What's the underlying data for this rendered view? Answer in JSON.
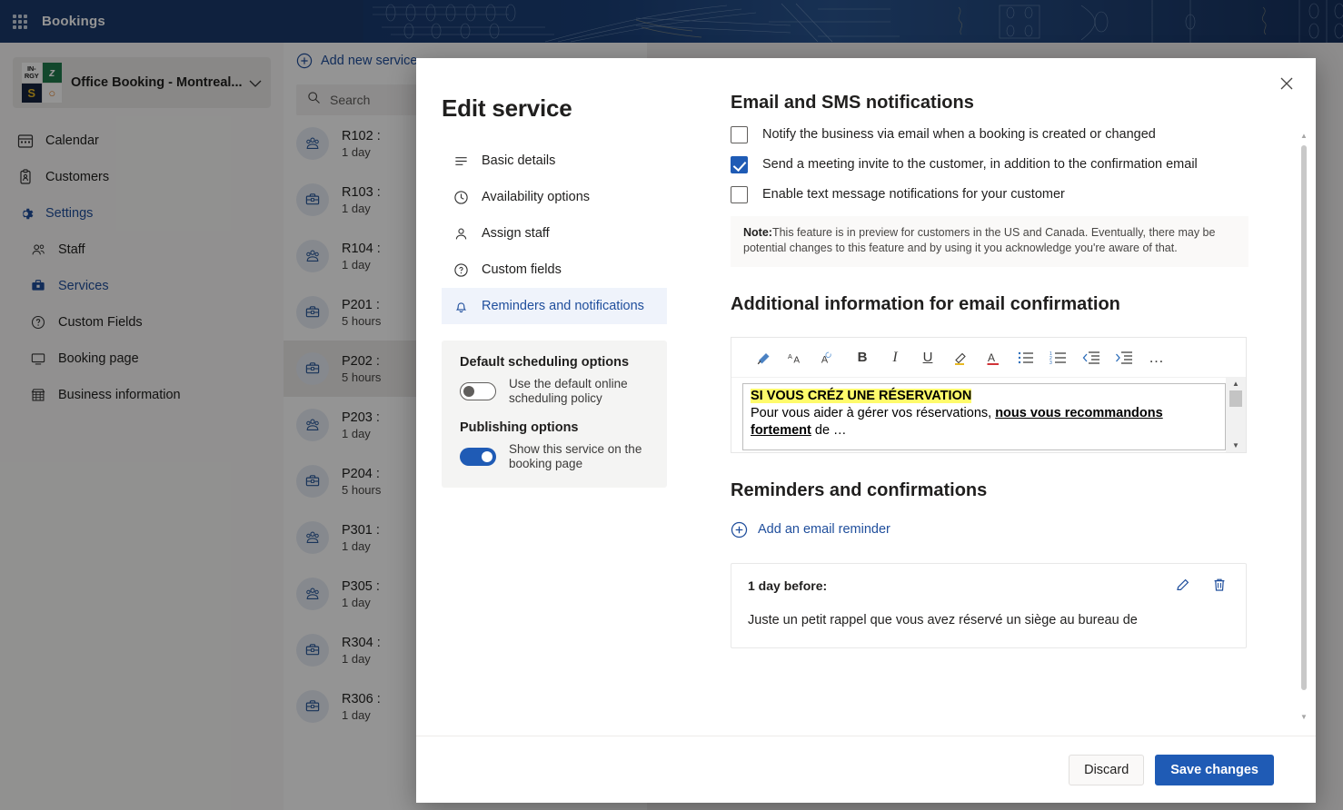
{
  "colors": {
    "brand_blue": "#1f5bb5",
    "link_blue": "#1f4e9c",
    "banner_navy": "#15325e",
    "highlight_yellow": "#fffb6b"
  },
  "topbar": {
    "waffle_icon": "app-launcher-grid-icon",
    "app_title": "Bookings"
  },
  "left_rail": {
    "tenant": {
      "logo_tiles": [
        "IN-RGY",
        "z",
        "S",
        "○"
      ],
      "name": "Office Booking - Montreal...",
      "chevron_icon": "chevron-down-icon"
    },
    "nav": [
      {
        "label": "Calendar",
        "icon": "calendar-icon",
        "active": false,
        "sub": false
      },
      {
        "label": "Customers",
        "icon": "customers-icon",
        "active": false,
        "sub": false
      },
      {
        "label": "Settings",
        "icon": "gear-icon",
        "active": true,
        "sub": false
      },
      {
        "label": "Staff",
        "icon": "people-icon",
        "active": false,
        "sub": true
      },
      {
        "label": "Services",
        "icon": "toolbox-icon",
        "active": true,
        "sub": true
      },
      {
        "label": "Custom Fields",
        "icon": "question-circle-icon",
        "active": false,
        "sub": true
      },
      {
        "label": "Booking page",
        "icon": "monitor-icon",
        "active": false,
        "sub": true
      },
      {
        "label": "Business information",
        "icon": "storefront-icon",
        "active": false,
        "sub": true
      }
    ]
  },
  "service_list": {
    "add_new_label": "Add new service",
    "add_new_icon": "circle-plus-icon",
    "search_placeholder": "Search",
    "search_icon": "search-icon",
    "items": [
      {
        "name": "R102 :",
        "duration": "1 day",
        "icon": "people-icon",
        "selected": false
      },
      {
        "name": "R103 :",
        "duration": "1 day",
        "icon": "toolbox-icon",
        "selected": false
      },
      {
        "name": "R104 :",
        "duration": "1 day",
        "icon": "people-icon",
        "selected": false
      },
      {
        "name": "P201 :",
        "duration": "5 hours",
        "icon": "toolbox-icon",
        "selected": false
      },
      {
        "name": "P202 :",
        "duration": "5 hours",
        "icon": "toolbox-icon",
        "selected": true
      },
      {
        "name": "P203 :",
        "duration": "1 day",
        "icon": "people-icon",
        "selected": false
      },
      {
        "name": "P204 :",
        "duration": "5 hours",
        "icon": "toolbox-icon",
        "selected": false
      },
      {
        "name": "P301 :",
        "duration": "1 day",
        "icon": "people-icon",
        "selected": false
      },
      {
        "name": "P305 :",
        "duration": "1 day",
        "icon": "people-icon",
        "selected": false
      },
      {
        "name": "R304 :",
        "duration": "1 day",
        "icon": "toolbox-icon",
        "selected": false
      },
      {
        "name": "R306 :",
        "duration": "1 day",
        "icon": "toolbox-icon",
        "selected": false
      }
    ]
  },
  "modal": {
    "title": "Edit service",
    "close_icon": "close-icon",
    "nav": [
      {
        "label": "Basic details",
        "icon": "list-lines-icon",
        "active": false
      },
      {
        "label": "Availability options",
        "icon": "clock-icon",
        "active": false
      },
      {
        "label": "Assign staff",
        "icon": "person-icon",
        "active": false
      },
      {
        "label": "Custom fields",
        "icon": "question-circle-icon",
        "active": false
      },
      {
        "label": "Reminders and notifications",
        "icon": "bell-icon",
        "active": true
      }
    ],
    "options_card": {
      "default_scheduling_heading": "Default scheduling options",
      "default_scheduling_label": "Use the default online scheduling policy",
      "default_scheduling_on": false,
      "publishing_heading": "Publishing options",
      "publishing_label": "Show this service on the booking page",
      "publishing_on": true
    },
    "notifications": {
      "heading": "Email and SMS notifications",
      "checkboxes": [
        {
          "label": "Notify the business via email when a booking is created or changed",
          "checked": false
        },
        {
          "label": "Send a meeting invite to the customer, in addition to the confirmation email",
          "checked": true
        },
        {
          "label": "Enable text message notifications for your customer",
          "checked": false
        }
      ],
      "note_prefix": "Note:",
      "note_text": "This feature is in preview for customers in the US and Canada. Eventually, there may be potential changes to this feature and by using it you acknowledge you're aware of that."
    },
    "additional_info": {
      "heading": "Additional information for email confirmation",
      "toolbar": [
        {
          "icon": "format-painter-icon",
          "glyph": "✐"
        },
        {
          "icon": "grow-font-icon",
          "glyph": "A"
        },
        {
          "icon": "shrink-font-icon",
          "glyph": "A"
        },
        {
          "icon": "bold-icon",
          "glyph": "B"
        },
        {
          "icon": "italic-icon",
          "glyph": "I"
        },
        {
          "icon": "underline-icon",
          "glyph": "U"
        },
        {
          "icon": "highlight-icon",
          "glyph": "✎"
        },
        {
          "icon": "font-color-icon",
          "glyph": "A"
        },
        {
          "icon": "bulleted-list-icon",
          "glyph": "≡"
        },
        {
          "icon": "numbered-list-icon",
          "glyph": "≡"
        },
        {
          "icon": "decrease-indent-icon",
          "glyph": "≡"
        },
        {
          "icon": "increase-indent-icon",
          "glyph": "≡"
        },
        {
          "icon": "more-options-icon",
          "glyph": "…"
        }
      ],
      "content_line1": "SI VOUS CRÉZ UNE RÉSERVATION",
      "content_line2_a": "Pour vous aider à gérer vos réservations, ",
      "content_line2_b": "nous vous recommandons fortement",
      "content_line2_c": " de …"
    },
    "reminders": {
      "heading": "Reminders and confirmations",
      "add_label": "Add an email reminder",
      "add_icon": "circle-plus-icon",
      "cards": [
        {
          "when": "1 day before:",
          "body": "Juste un petit rappel que vous avez réservé un siège au bureau de",
          "edit_icon": "pencil-icon",
          "delete_icon": "trash-icon"
        }
      ]
    },
    "footer": {
      "discard_label": "Discard",
      "save_label": "Save changes"
    }
  }
}
